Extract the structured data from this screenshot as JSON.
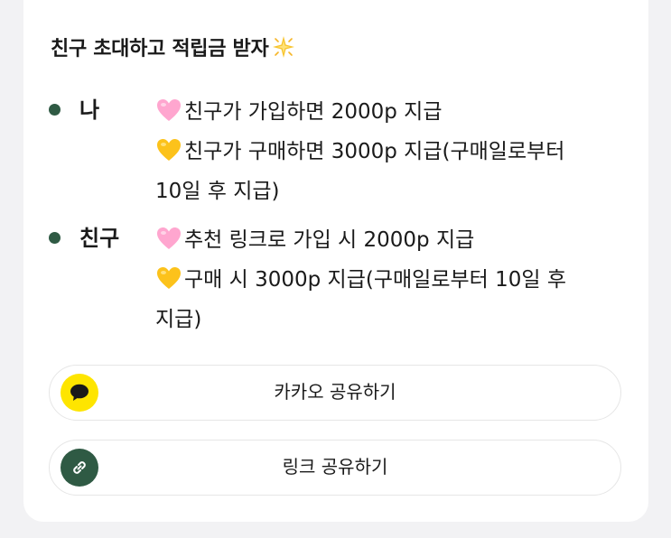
{
  "invite": {
    "title": "친구 초대하고 적립금 받자",
    "me": {
      "label": "나",
      "line1": "친구가 가입하면 2000p 지급",
      "line2": "친구가 구매하면 3000p 지급(구매일로부터",
      "line3": "10일 후 지급)"
    },
    "friend": {
      "label": "친구",
      "line1": "추천 링크로 가입 시 2000p 지급",
      "line2": "구매 시 3000p 지급(구매일로부터 10일 후",
      "line3": "지급)"
    },
    "kakao_share_label": "카카오 공유하기",
    "link_share_label": "링크 공유하기"
  },
  "icons": {
    "title_emoji": "glowing-star-icon",
    "signup_emoji": "pink-heart-icon",
    "purchase_emoji": "yellow-heart-icon",
    "kakao": "kakao-talk-bubble-icon",
    "link": "link-icon"
  },
  "colors": {
    "bullet": "#2f5a44",
    "kakao_yellow": "#fee500",
    "link_green": "#2f5a44"
  }
}
